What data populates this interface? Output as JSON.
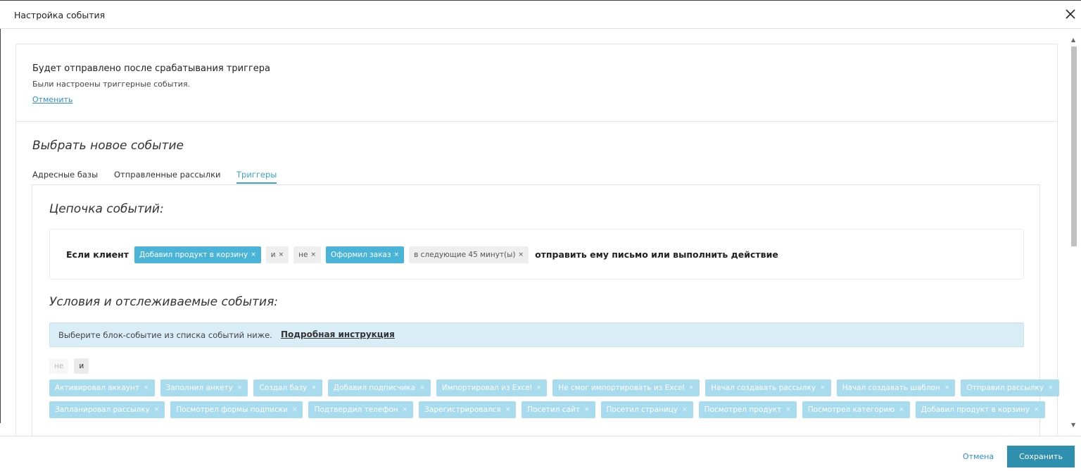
{
  "window": {
    "title": "Настройка события"
  },
  "info": {
    "heading": "Будет отправлено после срабатывания триггера",
    "subtitle": "Были настроены триггерные события.",
    "cancel_link": "Отменить"
  },
  "choose_heading": "Выбрать новое событие",
  "tabs": [
    {
      "label": "Адресные базы",
      "active": false
    },
    {
      "label": "Отправленные рассылки",
      "active": false
    },
    {
      "label": "Триггеры",
      "active": true
    }
  ],
  "chain": {
    "heading": "Цепочка событий:",
    "prefix": "Если клиент",
    "chips": [
      {
        "label": "Добавил продукт в корзину",
        "style": "blue"
      },
      {
        "label": "и",
        "style": "grey"
      },
      {
        "label": "не",
        "style": "grey"
      },
      {
        "label": "Оформил заказ",
        "style": "blue"
      },
      {
        "label": "в следующие 45 минут(ы)",
        "style": "grey"
      }
    ],
    "suffix": "отправить ему письмо или выполнить действие"
  },
  "conditions": {
    "heading": "Условия и отслеживаемые события:",
    "alert_text": "Выберите блок-событие из списка событий ниже.",
    "alert_link": "Подробная инструкция",
    "toggle": [
      "не",
      "и"
    ]
  },
  "events": [
    [
      "Активировал аккаунт",
      "Заполнил анкету",
      "Создал базу",
      "Добавил подписчика",
      "Импортировал из Excel",
      "Не смог импортировать из Excel",
      "Начал создавать рассылку",
      "Начал создавать шаблон",
      "Отправил рассылку"
    ],
    [
      "Запланировал рассылку",
      "Посмотрел формы подписки",
      "Подтвердил телефон",
      "Зарегистрировался",
      "Посетил сайт",
      "Посетил страницу",
      "Посмотрел продукт",
      "Посмотрел категорию",
      "Добавил продукт в корзину"
    ]
  ],
  "footer": {
    "cancel": "Отмена",
    "save": "Сохранить"
  },
  "icons": {
    "close": "close-icon",
    "remove": "×"
  },
  "colors": {
    "accent": "#4ab3d8",
    "save": "#2f8fae",
    "link": "#2b8fd0"
  }
}
